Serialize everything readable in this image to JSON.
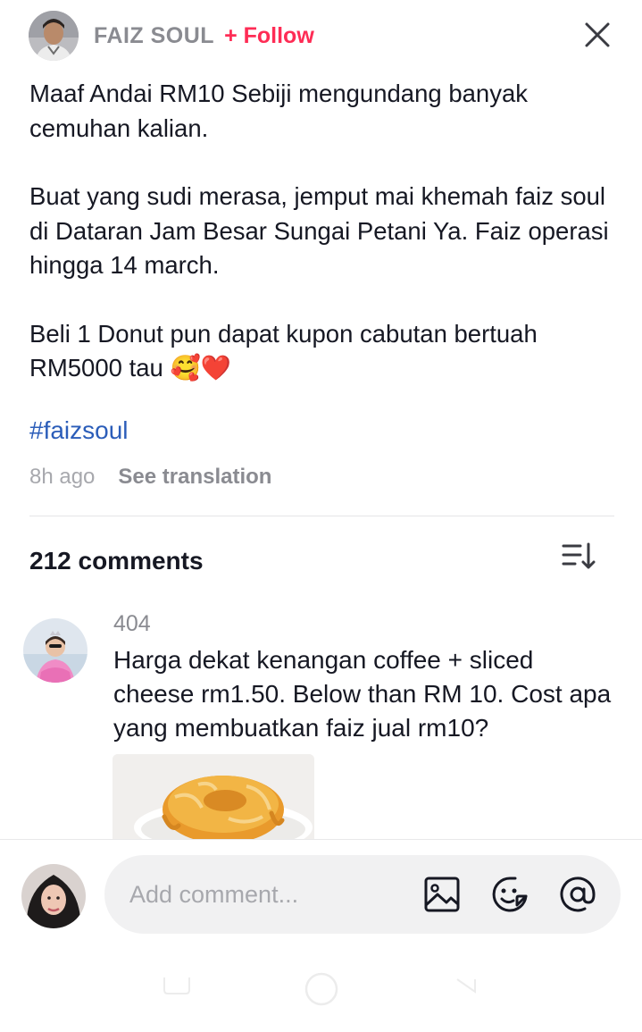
{
  "post": {
    "author": "FAIZ SOUL",
    "follow_label": "+ Follow",
    "paragraphs": [
      "Maaf Andai RM10 Sebiji mengundang banyak cemuhan kalian.",
      "Buat yang sudi merasa, jemput mai khemah faiz soul di Dataran Jam Besar Sungai Petani Ya. Faiz operasi hingga 14 march.",
      "Beli 1 Donut pun dapat kupon cabutan bertuah RM5000 tau 🥰❤️"
    ],
    "hashtag": "#faizsoul",
    "time": "8h ago",
    "see_translation": "See translation"
  },
  "comments_header": {
    "count_label": "212 comments"
  },
  "comments": [
    {
      "user": "404",
      "text": "Harga dekat kenangan coffee + sliced cheese rm1.50. Below than RM 10. Cost apa yang membuatkan faiz jual rm10?"
    }
  ],
  "composer": {
    "placeholder": "Add comment..."
  },
  "icons": {
    "close": "close-icon",
    "sort": "sort-icon",
    "image": "image-icon",
    "emoji": "emoji-icon",
    "mention": "at-mention-icon"
  },
  "colors": {
    "follow": "#fe2c55",
    "hashtag": "#2b5db9",
    "muted": "#8a8b91",
    "text": "#161823",
    "input_bg": "#f1f1f2"
  }
}
